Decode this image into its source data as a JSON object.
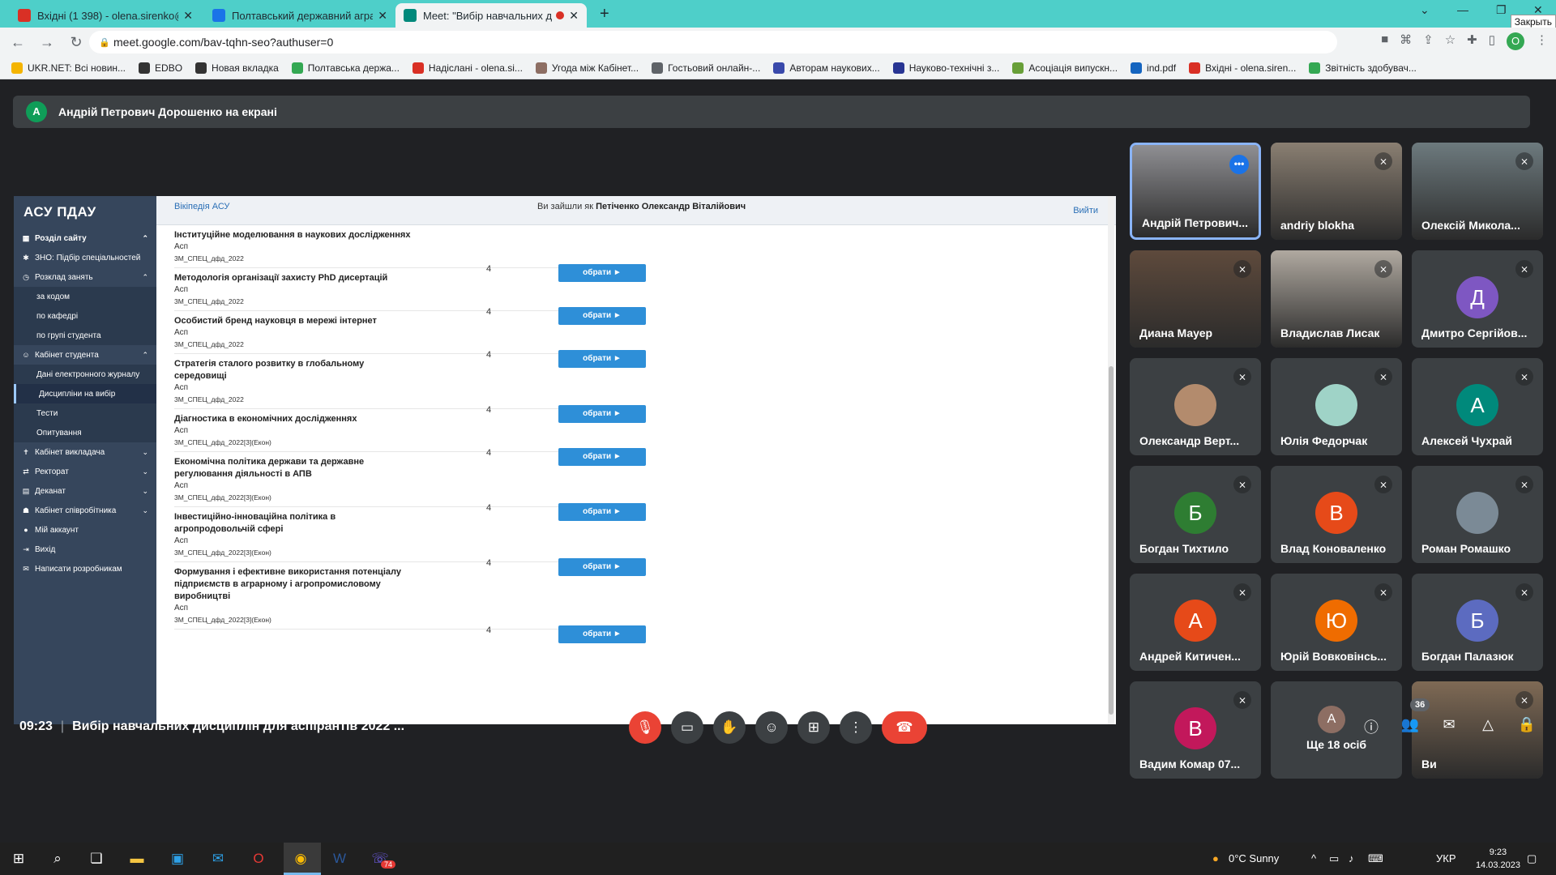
{
  "browser": {
    "tabs": [
      {
        "title": "Вхідні (1 398) - olena.sirenko@p",
        "icon_color": "#d93025"
      },
      {
        "title": "Полтавський державний аграр",
        "icon_color": "#1a73e8"
      },
      {
        "title": "Meet: \"Вибір навчальних ди",
        "icon_color": "#00897b"
      }
    ],
    "close_tooltip": "Закрыть",
    "url": "meet.google.com/bav-tqhn-seo?authuser=0",
    "profile_letter": "O",
    "bookmarks": [
      {
        "label": "UKR.NET: Всі новин...",
        "color": "#f4b400"
      },
      {
        "label": "EDBO",
        "color": "#333333"
      },
      {
        "label": "Новая вкладка",
        "color": "#333333"
      },
      {
        "label": "Полтавська держа...",
        "color": "#34a853"
      },
      {
        "label": "Надіслані - olena.si...",
        "color": "#d93025"
      },
      {
        "label": "Угода між Кабінет...",
        "color": "#8d6e63"
      },
      {
        "label": "Гостьовий онлайн-...",
        "color": "#5f6368"
      },
      {
        "label": "Авторам наукових...",
        "color": "#3949ab"
      },
      {
        "label": "Науково-технічні з...",
        "color": "#283593"
      },
      {
        "label": "Асоціація випускн...",
        "color": "#689f38"
      },
      {
        "label": "ind.pdf",
        "color": "#1565c0"
      },
      {
        "label": "Вхідні - olena.siren...",
        "color": "#d93025"
      },
      {
        "label": "Звітність здобувач...",
        "color": "#34a853"
      }
    ]
  },
  "meet": {
    "presenter_initial": "А",
    "presenter_text": "Андрій Петрович Дорошенко на екрані",
    "meeting_time": "09:23",
    "meeting_title": "Вибір навчальних дисциплін для аспірантів 2022 ...",
    "participants_count": "36",
    "tiles": [
      {
        "name": "Андрій Петрович...",
        "kind": "photo",
        "bg": "#8f8f93",
        "speaking": true
      },
      {
        "name": "andriy blokha",
        "kind": "photo",
        "bg": "#8a7f72"
      },
      {
        "name": "Олексій Микола...",
        "kind": "photo",
        "bg": "#6d7a7e"
      },
      {
        "name": "Диана Мауер",
        "kind": "photo",
        "bg": "#5e4a3c"
      },
      {
        "name": "Владислав Лисак",
        "kind": "photo",
        "bg": "#b0a9a0"
      },
      {
        "name": "Дмитро Сергійов...",
        "kind": "letter",
        "letter": "Д",
        "bg": "#7e57c2"
      },
      {
        "name": "Олександр Верт...",
        "kind": "small-photo",
        "bg": "#b38b6d"
      },
      {
        "name": "Юлія Федорчак",
        "kind": "small-photo",
        "bg": "#9fd3c7"
      },
      {
        "name": "Алексей Чухрай",
        "kind": "letter",
        "letter": "А",
        "bg": "#00897b"
      },
      {
        "name": "Богдан Тихтило",
        "kind": "letter",
        "letter": "Б",
        "bg": "#2e7d32"
      },
      {
        "name": "Влад Коноваленко",
        "kind": "letter",
        "letter": "В",
        "bg": "#e64a19"
      },
      {
        "name": "Роман Ромашко",
        "kind": "small-photo",
        "bg": "#7b8a96"
      },
      {
        "name": "Андрей Китичен...",
        "kind": "letter",
        "letter": "А",
        "bg": "#e64a19"
      },
      {
        "name": "Юрій Вовковінсь...",
        "kind": "letter",
        "letter": "Ю",
        "bg": "#ef6c00"
      },
      {
        "name": "Богдан Палазюк",
        "kind": "letter",
        "letter": "Б",
        "bg": "#5c6bc0"
      },
      {
        "name": "Вадим Комар 07...",
        "kind": "letter",
        "letter": "В",
        "bg": "#c2185b"
      },
      {
        "name": "Ще 18 осіб",
        "kind": "others",
        "letter": "А",
        "bg": "#8d6e63"
      },
      {
        "name": "Ви",
        "kind": "photo",
        "bg": "#7f6a55"
      }
    ]
  },
  "asu": {
    "title": "АСУ ПДАУ",
    "wiki_link": "Вікіпедія АСУ",
    "logged_prefix": "Ви зайшли як",
    "logged_user": "Петіченко Олександр Віталійович",
    "logout": "Вийти",
    "sidebar": [
      {
        "label": "Розділ сайту",
        "icon": "▦",
        "chev": "^",
        "bold": true
      },
      {
        "label": "ЗНО: Підбір спеціальностей",
        "icon": "✱",
        "chev": ""
      },
      {
        "label": "Розклад занять",
        "icon": "◷",
        "chev": "^"
      },
      {
        "label": "за кодом",
        "sub": true
      },
      {
        "label": "по кафедрі",
        "sub": true
      },
      {
        "label": "по групі студента",
        "sub": true
      },
      {
        "label": "Кабінет студента",
        "icon": "☺",
        "chev": "^"
      },
      {
        "label": "Дані електронного журналу",
        "sub": true
      },
      {
        "label": "Дисципліни на вибір",
        "sub": true,
        "hl": true
      },
      {
        "label": "Тести",
        "sub": true
      },
      {
        "label": "Опитування",
        "sub": true
      },
      {
        "label": "Кабінет викладача",
        "icon": "✝",
        "chev": "v"
      },
      {
        "label": "Ректорат",
        "icon": "⇄",
        "chev": "v"
      },
      {
        "label": "Деканат",
        "icon": "▤",
        "chev": "v"
      },
      {
        "label": "Кабінет співробітника",
        "icon": "☗",
        "chev": "v"
      },
      {
        "label": "Мій аккаунт",
        "icon": "●",
        "chev": ""
      },
      {
        "label": "Вихід",
        "icon": "⇥",
        "chev": ""
      },
      {
        "label": "Написати розробникам",
        "icon": "✉",
        "chev": ""
      }
    ],
    "disciplines": [
      {
        "name": "Інституційне моделювання в наукових дослідженнях",
        "type": "Асп",
        "code": "3М_СПЕЦ_дфд_2022",
        "credits": "4",
        "button": "обрати ►"
      },
      {
        "name": "Методологія організації захисту PhD дисертацій",
        "type": "Асп",
        "code": "3М_СПЕЦ_дфд_2022",
        "credits": "4",
        "button": "обрати ►"
      },
      {
        "name": "Особистий бренд науковця в мережі інтернет",
        "type": "Асп",
        "code": "3М_СПЕЦ_дфд_2022",
        "credits": "4",
        "button": "обрати ►"
      },
      {
        "name": "Стратегія сталого розвитку в глобальному середовищі",
        "type": "Асп",
        "code": "3М_СПЕЦ_дфд_2022",
        "credits": "4",
        "button": "обрати ►"
      },
      {
        "name": "Діагностика в економічних дослідженнях",
        "type": "Асп",
        "code": "3М_СПЕЦ_дфд_2022[3](Екон)",
        "credits": "4",
        "button": "обрати ►"
      },
      {
        "name": "Економічна політика держави та державне регулювання діяльності в АПВ",
        "type": "Асп",
        "code": "3М_СПЕЦ_дфд_2022[3](Екон)",
        "credits": "4",
        "button": "обрати ►"
      },
      {
        "name": "Інвестиційно-інноваційна політика в агропродовольчій сфері",
        "type": "Асп",
        "code": "3М_СПЕЦ_дфд_2022[3](Екон)",
        "credits": "4",
        "button": "обрати ►"
      },
      {
        "name": "Формування і ефективне використання потенціалу підприємств в аграрному і агропромисловому виробництві",
        "type": "Асп",
        "code": "3М_СПЕЦ_дфд_2022[3](Екон)",
        "credits": "4",
        "button": "обрати ►"
      }
    ]
  },
  "taskbar": {
    "weather": "0°C  Sunny",
    "lang": "УКР",
    "time": "9:23",
    "date": "14.03.2023",
    "viber_badge": "74"
  }
}
